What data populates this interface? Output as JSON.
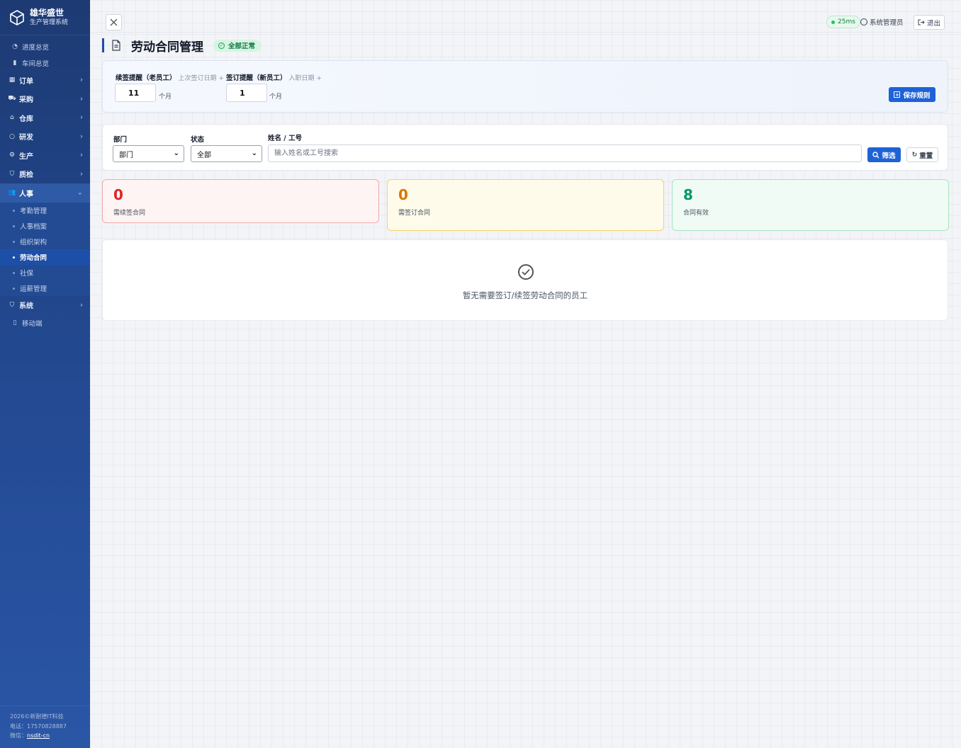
{
  "brand": {
    "name": "雄华盛世",
    "subtitle": "生产管理系统"
  },
  "sidebar": {
    "top_items": [
      {
        "label": "进度总览",
        "icon": "dashboard-icon"
      },
      {
        "label": "车间总览",
        "icon": "building-icon"
      }
    ],
    "groups": [
      {
        "label": "订单",
        "icon": "order-icon"
      },
      {
        "label": "采购",
        "icon": "cart-icon"
      },
      {
        "label": "仓库",
        "icon": "warehouse-icon"
      },
      {
        "label": "研发",
        "icon": "bulb-icon"
      },
      {
        "label": "生产",
        "icon": "gear-icon"
      },
      {
        "label": "质检",
        "icon": "shield-icon"
      }
    ],
    "hr_group": {
      "label": "人事",
      "icon": "users-icon",
      "children": [
        "考勤管理",
        "人事档案",
        "组织架构",
        "劳动合同",
        "社保",
        "运薪管理"
      ],
      "active": "劳动合同"
    },
    "bottom_items": [
      {
        "label": "系统",
        "icon": "shield-icon"
      },
      {
        "label": "移动端",
        "icon": "mobile-icon"
      }
    ],
    "footer": {
      "copyright": "2026©新耐德IT科技",
      "phone": "电话：17570828887",
      "wechat_label": "微信：",
      "wechat_id": "nsdit-cn"
    }
  },
  "topbar": {
    "latency": "25ms",
    "user": "系统管理员",
    "logout": "退出"
  },
  "page": {
    "title": "劳动合同管理",
    "status_badge": "全部正常"
  },
  "rules": {
    "renew": {
      "label": "续签提醒（老员工）",
      "hint": "上次签订日期 +",
      "value": "11",
      "unit": "个月"
    },
    "sign": {
      "label": "签订提醒（新员工）",
      "hint": "入职日期 +",
      "value": "1",
      "unit": "个月"
    },
    "save_label": "保存规则"
  },
  "filters": {
    "dept_label": "部门",
    "dept_value": "部门",
    "status_label": "状态",
    "status_value": "全部",
    "search_label": "姓名 / 工号",
    "search_placeholder": "输入姓名或工号搜索",
    "filter_button": "筛选",
    "reset_button": "重置"
  },
  "stats": [
    {
      "value": "0",
      "caption": "需续签合同",
      "color": "#dc2626"
    },
    {
      "value": "0",
      "caption": "需签订合同",
      "color": "#d97706"
    },
    {
      "value": "8",
      "caption": "合同有效",
      "color": "#059669"
    }
  ],
  "empty_state": {
    "message": "暂无需要签订/续签劳动合同的员工"
  }
}
